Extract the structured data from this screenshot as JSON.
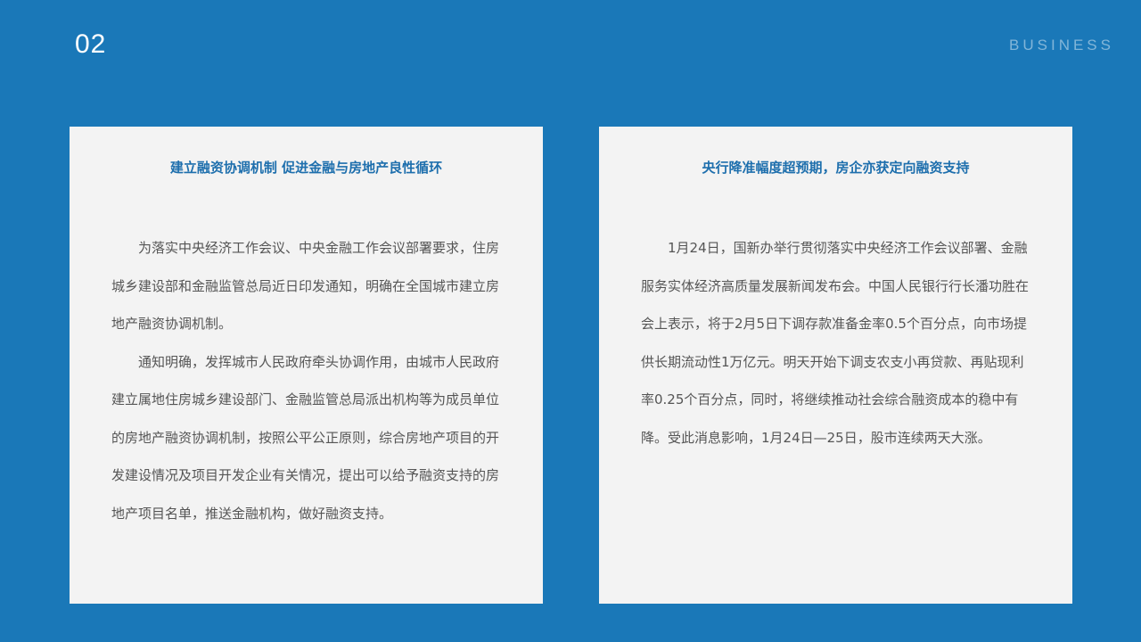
{
  "header": {
    "slide_number": "02",
    "section_tag": "BUSINESS"
  },
  "cards": [
    {
      "title": "建立融资协调机制  促进金融与房地产良性循环",
      "paragraphs": [
        "为落实中央经济工作会议、中央金融工作会议部署要求，住房城乡建设部和金融监管总局近日印发通知，明确在全国城市建立房地产融资协调机制。",
        "通知明确，发挥城市人民政府牵头协调作用，由城市人民政府建立属地住房城乡建设部门、金融监管总局派出机构等为成员单位的房地产融资协调机制，按照公平公正原则，综合房地产项目的开发建设情况及项目开发企业有关情况，提出可以给予融资支持的房地产项目名单，推送金融机构，做好融资支持。"
      ]
    },
    {
      "title": "央行降准幅度超预期，房企亦获定向融资支持",
      "paragraphs": [
        "1月24日，国新办举行贯彻落实中央经济工作会议部署、金融服务实体经济高质量发展新闻发布会。中国人民银行行长潘功胜在会上表示，将于2月5日下调存款准备金率0.5个百分点，向市场提供长期流动性1万亿元。明天开始下调支农支小再贷款、再贴现利率0.25个百分点，同时，将继续推动社会综合融资成本的稳中有降。受此消息影响，1月24日—25日，股市连续两天大涨。"
      ]
    }
  ]
}
